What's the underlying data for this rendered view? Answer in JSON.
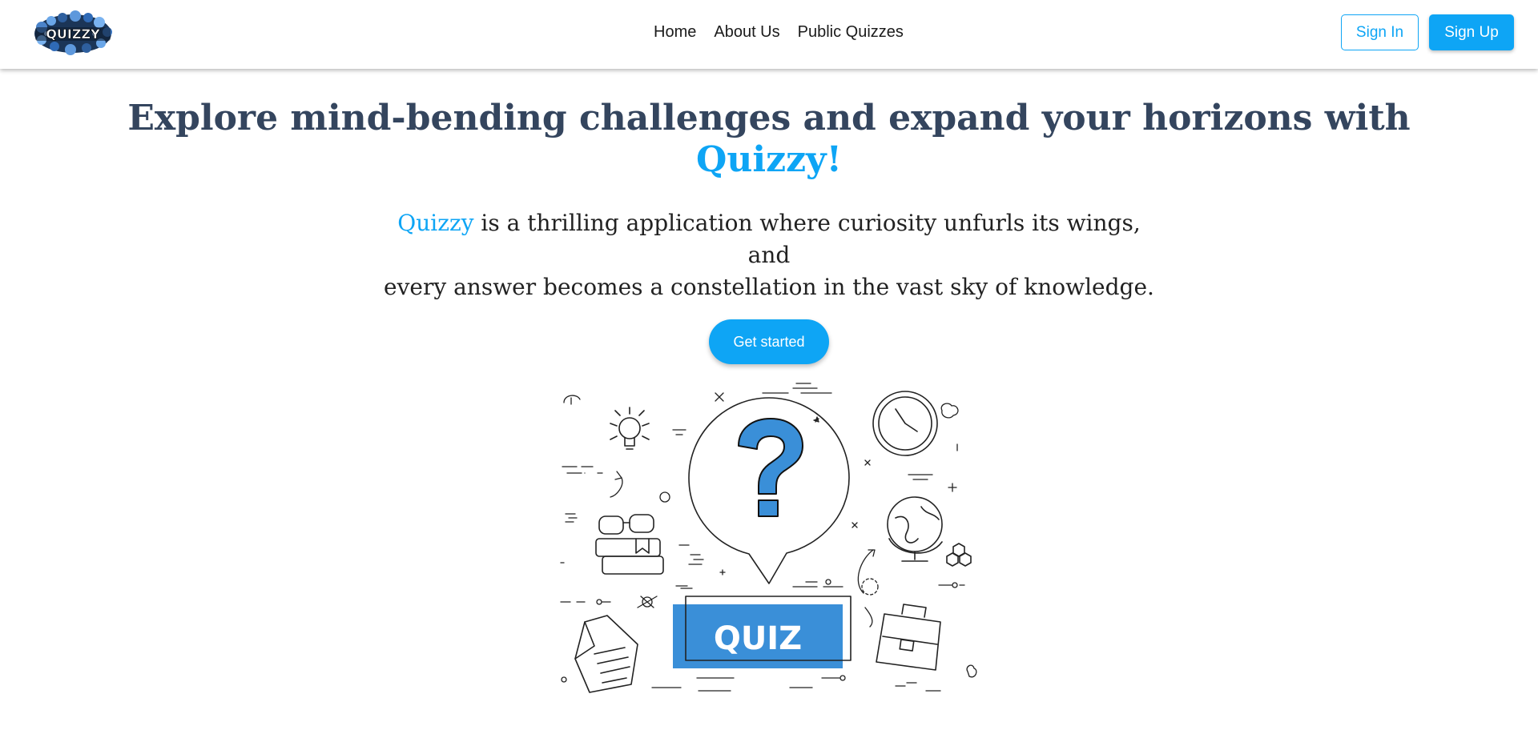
{
  "header": {
    "logo_text": "QUIZZY",
    "nav": [
      {
        "label": "Home"
      },
      {
        "label": "About Us"
      },
      {
        "label": "Public Quizzes"
      }
    ],
    "sign_in_label": "Sign In",
    "sign_up_label": "Sign Up"
  },
  "hero": {
    "title_main": "Explore mind-bending challenges and expand your horizons with",
    "title_accent": "Quizzy!",
    "text_accent": "Quizzy",
    "text_line1": " is a thrilling application where curiosity unfurls its wings,",
    "text_line2": "and",
    "text_line3": "every answer becomes a constellation in the vast sky of knowledge.",
    "cta_label": "Get started"
  },
  "illustration": {
    "badge_text": "QUIZ",
    "accent_color": "#3a8fd8"
  },
  "colors": {
    "primary": "#0ea5f5",
    "title": "#34455e"
  }
}
